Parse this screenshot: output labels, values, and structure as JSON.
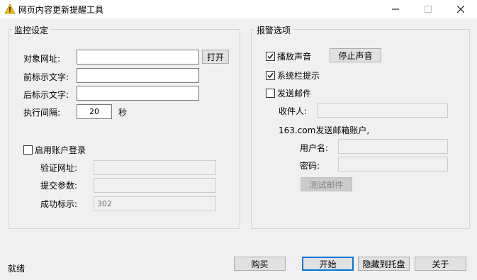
{
  "window": {
    "title": "网页内容更新提醒工具",
    "icon": "warning-icon"
  },
  "monitor": {
    "group_title": "监控设定",
    "url_label": "对象网址:",
    "url_value": "",
    "open_button": "打开",
    "prefix_label": "前标示文字:",
    "prefix_value": "",
    "suffix_label": "后标示文字:",
    "suffix_value": "",
    "interval_label": "执行间隔:",
    "interval_value": "20",
    "interval_unit": "秒",
    "account_login_label": "启用账户登录",
    "account_login_checked": false,
    "verify_url_label": "验证网址:",
    "verify_url_value": "",
    "submit_params_label": "提交参数:",
    "submit_params_value": "",
    "success_label": "成功标示:",
    "success_value": "302"
  },
  "alarm": {
    "group_title": "报警选项",
    "play_sound_label": "播放声音",
    "play_sound_checked": true,
    "stop_sound_button": "停止声音",
    "tray_tip_label": "系统栏提示",
    "tray_tip_checked": true,
    "send_mail_label": "发送邮件",
    "send_mail_checked": false,
    "recipient_label": "收件人:",
    "recipient_value": "",
    "sender_account_label": "163.com发送邮箱账户,",
    "username_label": "用户名:",
    "username_value": "",
    "password_label": "密码:",
    "password_value": "",
    "test_mail_button": "测试邮件"
  },
  "footer": {
    "status": "就绪",
    "buy_button": "购买",
    "start_button": "开始",
    "hide_tray_button": "隐藏到托盘",
    "about_button": "关于"
  }
}
